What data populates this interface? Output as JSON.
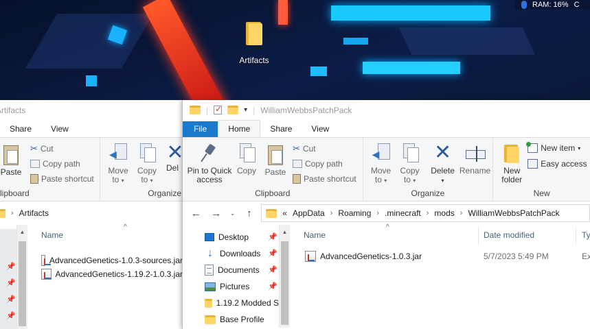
{
  "desktop": {
    "icon_label": "Artifacts",
    "tray_text": "RAM: 16%",
    "tray_extra": "C"
  },
  "left_window": {
    "title": "Artifacts",
    "tabs": [
      "Share",
      "View"
    ],
    "ribbon": {
      "clipboard": {
        "paste": "Paste",
        "cut": "Cut",
        "copy_path": "Copy path",
        "paste_shortcut": "Paste shortcut",
        "group_label": "lipboard"
      },
      "organize": {
        "move_to": [
          "Move",
          "to"
        ],
        "copy_to": [
          "Copy",
          "to"
        ],
        "delete_partial": "Del",
        "group_label": "Organize"
      }
    },
    "address": "Artifacts",
    "column_name": "Name",
    "files": [
      "AdvancedGenetics-1.0.3-sources.jar",
      "AdvancedGenetics-1.19.2-1.0.3.jar"
    ]
  },
  "right_window": {
    "title": "WilliamWebbsPatchPack",
    "tabs": {
      "file": "File",
      "home": "Home",
      "share": "Share",
      "view": "View"
    },
    "ribbon": {
      "clipboard": {
        "pin": [
          "Pin to Quick",
          "access"
        ],
        "copy": "Copy",
        "paste": "Paste",
        "cut": "Cut",
        "copy_path": "Copy path",
        "paste_shortcut": "Paste shortcut",
        "group_label": "Clipboard"
      },
      "organize": {
        "move_to": [
          "Move",
          "to"
        ],
        "copy_to": [
          "Copy",
          "to"
        ],
        "delete": "Delete",
        "rename": "Rename",
        "group_label": "Organize"
      },
      "new": {
        "new_folder": [
          "New",
          "folder"
        ],
        "new_item": "New item",
        "easy_access": "Easy access",
        "group_label": "New"
      }
    },
    "address": {
      "prefix": "«",
      "segments": [
        "AppData",
        "Roaming",
        ".minecraft",
        "mods",
        "WilliamWebbsPatchPack"
      ]
    },
    "nav_pane": [
      {
        "label": "Desktop",
        "icon": "desktop-icon",
        "pinned": true
      },
      {
        "label": "Downloads",
        "icon": "downloads-icon",
        "pinned": true
      },
      {
        "label": "Documents",
        "icon": "documents-icon",
        "pinned": true
      },
      {
        "label": "Pictures",
        "icon": "pictures-icon",
        "pinned": true
      },
      {
        "label": "1.19.2 Modded S",
        "icon": "folder-icon",
        "pinned": false
      },
      {
        "label": "Base Profile",
        "icon": "folder-icon",
        "pinned": false
      }
    ],
    "columns": {
      "name": "Name",
      "date_modified": "Date modified",
      "type_partial": "Ty"
    },
    "files": [
      {
        "name": "AdvancedGenetics-1.0.3.jar",
        "date": "5/7/2023 5:49 PM",
        "type": "Ex"
      }
    ]
  },
  "colors": {
    "file_tab": "#1979ca",
    "ribbon_bg": "#f5f6f7",
    "header_text": "#4c607a"
  }
}
